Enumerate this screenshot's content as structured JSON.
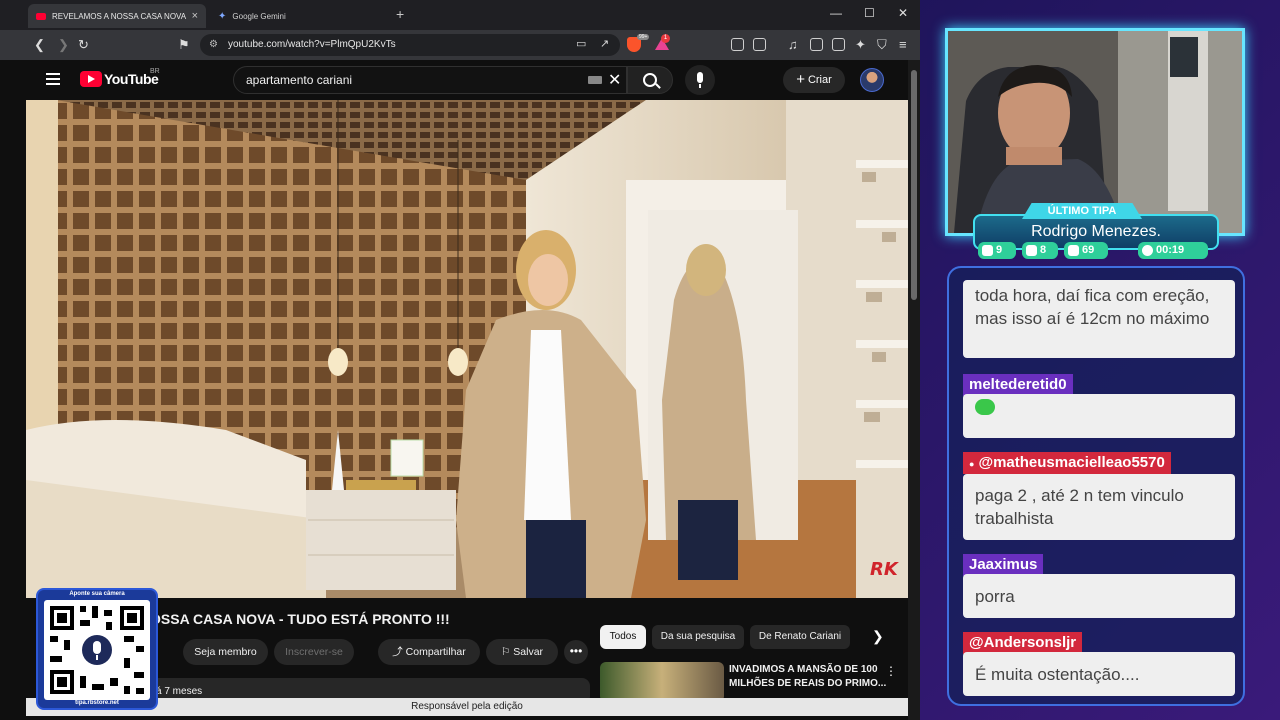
{
  "browser": {
    "tabs": [
      {
        "title": "REVELAMOS A NOSSA CASA NOVA - T",
        "close": "×"
      },
      {
        "title": "Google Gemini",
        "close": "×"
      }
    ],
    "new_tab": "+",
    "window_controls": {
      "minimize": "—",
      "maximize": "☐",
      "close": "✕"
    },
    "url": "youtube.com/watch?v=PlmQpU2KvTs",
    "brave_badge": "99+",
    "alert_badge": "1",
    "icons": [
      "back-icon",
      "forward-icon",
      "reload-icon",
      "bookmark-icon",
      "tune-icon",
      "cast-icon",
      "share-icon",
      "brave-shield-icon",
      "brave-rewards-icon",
      "extensions-icon",
      "media-icon",
      "sidebar-icon",
      "wallet-icon",
      "leo-icon",
      "vpn-icon",
      "menu-icon"
    ]
  },
  "youtube": {
    "logo_text": "YouTube",
    "region": "BR",
    "search_query": "apartamento cariani",
    "create_label": "Criar",
    "video_title": "OSSA CASA NOVA - TUDO ESTÁ PRONTO !!!",
    "watermark": "RK",
    "actions": {
      "join": "Seja membro",
      "subscribe": "Inscrever-se",
      "share": "Compartilhar",
      "save": "Salvar",
      "more": "•••"
    },
    "chips": [
      "Todos",
      "Da sua pesquisa",
      "De Renato Cariani"
    ],
    "recommended_title": "INVADIMOS A MANSÃO DE 100 MILHÕES DE REAIS DO PRIMO...",
    "description_meta": "á 7 meses",
    "footer": "Responsável pela edição"
  },
  "qr": {
    "top": "Aponte sua câmera",
    "bottom": "tipa.rbstore.net"
  },
  "overlay": {
    "last_tip_label": "ÚLTIMO TIPA",
    "last_tip_name": "Rodrigo Menezes.",
    "stats": [
      {
        "icon": "twitch-icon",
        "value": "9",
        "color": "#2fcf9a"
      },
      {
        "icon": "youtube-icon",
        "value": "8",
        "color": "#2fcf9a"
      },
      {
        "icon": "kick-icon",
        "value": "69",
        "color": "#2fcf9a"
      },
      {
        "icon": "clock-icon",
        "value": "00:19",
        "color": "#2fcf9a"
      }
    ]
  },
  "chat": [
    {
      "user": "",
      "text": "toda hora, daí fica com ereção, mas isso aí é 12cm no máximo"
    },
    {
      "user": "meltederetid0",
      "text": "",
      "emote": "green-emote",
      "user_color": "#6a2fbf"
    },
    {
      "user": "@matheusmacielleao5570",
      "text": "paga 2 , até 2 n tem vinculo trabalhista",
      "user_color": "#d3283d"
    },
    {
      "user": "Jaaximus",
      "text": "porra",
      "user_color": "#6a2fbf"
    },
    {
      "user": "@Andersonsljr",
      "text": "É muita ostentação....",
      "user_color": "#d3283d"
    }
  ]
}
